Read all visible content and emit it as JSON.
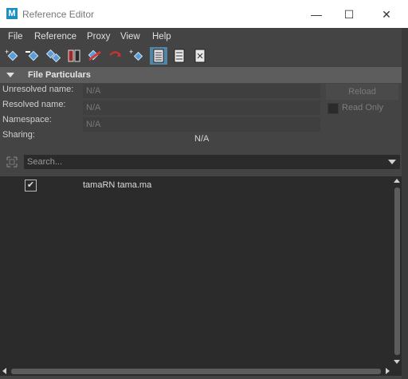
{
  "window": {
    "app_icon": "M",
    "title": "Reference Editor",
    "minimize_glyph": "—",
    "maximize_glyph": "☐",
    "close_glyph": "✕"
  },
  "menu": [
    "File",
    "Reference",
    "Proxy",
    "View",
    "Help"
  ],
  "toolbar_icons": [
    "create-reference-icon",
    "remove-reference-icon",
    "import-objects-icon",
    "duplicate-reference-icon",
    "unload-reference-icon",
    "reload-reference-icon",
    "select-file-contents-icon",
    "list-view-icon",
    "list-details-icon",
    "list-proxies-icon"
  ],
  "section": {
    "title": "File Particulars"
  },
  "fields": {
    "unresolved_label": "Unresolved name:",
    "unresolved_value": "N/A",
    "resolved_label": "Resolved name:",
    "resolved_value": "N/A",
    "namespace_label": "Namespace:",
    "namespace_value": "N/A",
    "sharing_label": "Sharing:",
    "sharing_value": "N/A"
  },
  "reload_label": "Reload",
  "read_only_label": "Read Only",
  "search": {
    "placeholder": "Search..."
  },
  "references": [
    {
      "checked": true,
      "check_glyph": "✔",
      "name": "tamaRN tama.ma"
    }
  ],
  "colors": {
    "panel": "#444444",
    "field": "#2b2b2b",
    "accent": "#5285a6",
    "header": "#5d5d5d"
  }
}
